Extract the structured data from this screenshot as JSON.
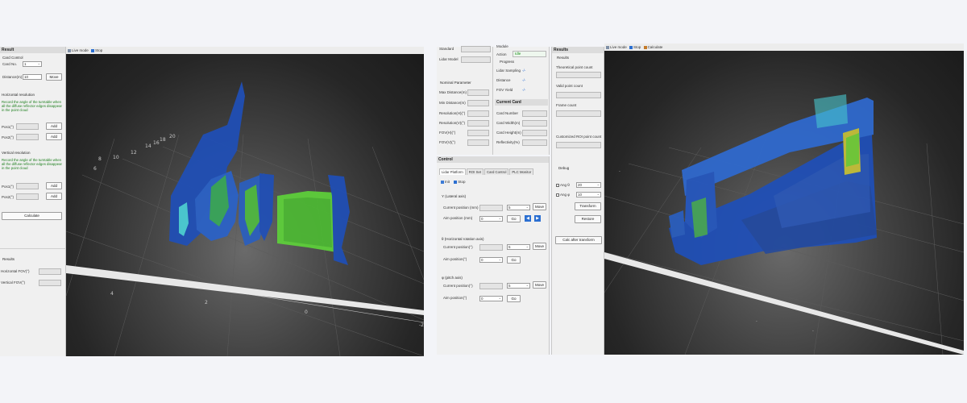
{
  "left": {
    "panel": {
      "header": "Result",
      "card_control_group": "Card Control",
      "card_no_label": "Card No.",
      "card_no_value": "1",
      "distance_label": "Distance(m)",
      "distance_value": "10",
      "move_button": "Move",
      "horizontal_group": "Horizontal resolution",
      "horizontal_hint": "Record the angle of the turntable when all the diffuse reflector edges disappear in the point cloud",
      "pos1_label": "Pos1(°)",
      "pos2_label": "Pos2(°)",
      "add_button": "Add",
      "vertical_group": "Vertical resolution",
      "vertical_hint": "Record the angle of the turntable when all the diffuse reflector edges disappear in the point cloud",
      "calculate_button": "Calculate",
      "results_group": "Results",
      "hfov_label": "Horizontal FOV(°)",
      "vfov_label": "Vertical FOV(°)"
    },
    "toolbar": {
      "live_mode": "Live mode",
      "stop": "Stop"
    },
    "axis_labels": [
      "-2",
      "0",
      "2",
      "4",
      "6",
      "8",
      "10",
      "12",
      "14",
      "16",
      "18",
      "20"
    ]
  },
  "right": {
    "top": {
      "standard_label": "Standard",
      "lidar_model_label": "Lidar Model",
      "module_label": "Module",
      "action_label": "Action",
      "action_value": "Idle",
      "progress_label": "Progress",
      "lidar_sampling_label": "Lidar Sampling",
      "distance_label": "Distance",
      "fov_yield_label": "FOV Yield",
      "status_value": "-/-",
      "nominal_group": "Nominal Parameter",
      "nominal_labels": [
        "Max Distance(m)",
        "Min Distance(m)",
        "Resolution(H)(°)",
        "Resolution(V)(°)",
        "FOV(H)(°)",
        "FOV(V)(°)"
      ],
      "current_card_group": "Current Card",
      "card_labels": [
        "Card Number",
        "Card Width(m)",
        "Card Height(m)",
        "Reflectivity(%)"
      ]
    },
    "control": {
      "header": "Control",
      "tabs": [
        "Lidar Platform",
        "ROI Set",
        "Card Control",
        "PLC Monitor"
      ],
      "init": "Init",
      "stop": "Stop",
      "y_group": "Y (Lateral axis)",
      "current_position_mm": "Current position (mm)",
      "aim_position_mm": "Aim position (mm)",
      "theta_group": "θ (Horizontal rotation axis)",
      "phi_group": "φ (pitch axis)",
      "current_position_deg": "Current position(°)",
      "aim_position_deg": "Aim position(°)",
      "step_value": "5",
      "aim_value": "0",
      "move_button": "Move",
      "go_button": "Go"
    },
    "results": {
      "header": "Results",
      "group": "Results",
      "theoretical": "Theoretical point count",
      "valid": "Valid point count",
      "frame": "Frame count",
      "customized": "Customized ROI point count",
      "debug_group": "Debug",
      "ang_theta_label": "Ang θ",
      "ang_theta_value": "20",
      "ang_phi_label": "Ang φ",
      "ang_phi_value": "10",
      "transform_button": "Transform",
      "restore_button": "Restore",
      "calc_after_transform": "Calc after transform"
    },
    "toolbar": {
      "live_mode": "Live mode",
      "stop": "Stop",
      "calculate": "Calculate"
    }
  },
  "colors": {
    "accent": "#2b6fd1",
    "green_text": "#1d7f1d",
    "points_blue": "#1f4fb8",
    "points_green": "#5ed23a",
    "points_cyan": "#4ad0d8"
  }
}
